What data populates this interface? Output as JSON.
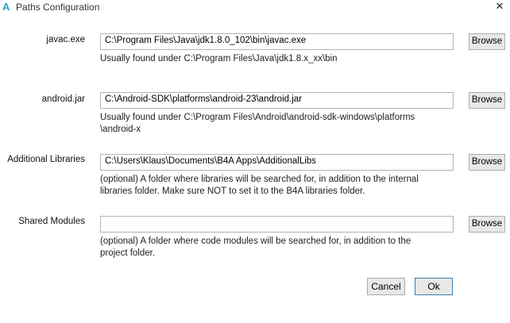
{
  "window": {
    "app_icon": "A",
    "title": "Paths Configuration",
    "close_glyph": "✕"
  },
  "rows": [
    {
      "label": "javac.exe",
      "value": "C:\\Program Files\\Java\\jdk1.8.0_102\\bin\\javac.exe",
      "button": "Browse",
      "hint": "Usually found under C:\\Program Files\\Java\\jdk1.8.x_xx\\bin"
    },
    {
      "label": "android.jar",
      "value": "C:\\Android-SDK\\platforms\\android-23\\android.jar",
      "button": "Browse",
      "hint": "Usually found under C:\\Program Files\\Android\\android-sdk-windows\\platforms\n\\android-x"
    },
    {
      "label": "Additional Libraries",
      "value": "C:\\Users\\Klaus\\Documents\\B4A Apps\\AdditionalLibs",
      "button": "Browse",
      "hint": "(optional) A folder where libraries will be searched for, in addition to the internal\nlibraries folder. Make sure NOT to set it to the B4A libraries folder."
    },
    {
      "label": "Shared Modules",
      "value": "",
      "button": "Browse",
      "hint": "(optional) A folder where code modules will be searched for, in addition to the\nproject folder."
    }
  ],
  "footer": {
    "cancel_label": "Cancel",
    "ok_label": "Ok"
  }
}
